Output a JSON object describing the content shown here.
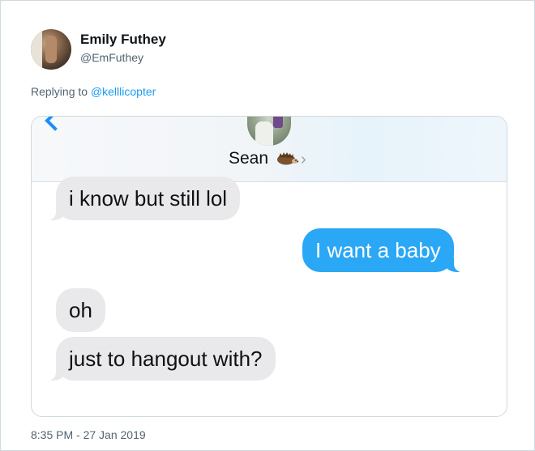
{
  "tweet": {
    "author_name": "Emily Futhey",
    "author_handle": "@EmFuthey",
    "replying_prefix": "Replying to ",
    "replying_to": "@kelllicopter",
    "timestamp": "8:35 PM - 27 Jan 2019"
  },
  "imessage": {
    "contact_name": "Sean",
    "icons": [
      "back-chevron-icon",
      "hedgehog-emoji-icon",
      "chevron-right-icon"
    ],
    "accent_color": "#2aa7f5",
    "messages": [
      {
        "direction": "incoming",
        "text": "i know but still lol"
      },
      {
        "direction": "outgoing",
        "text": "I want a baby"
      },
      {
        "direction": "incoming",
        "text": "oh"
      },
      {
        "direction": "incoming",
        "text": "just to hangout with?"
      }
    ]
  }
}
